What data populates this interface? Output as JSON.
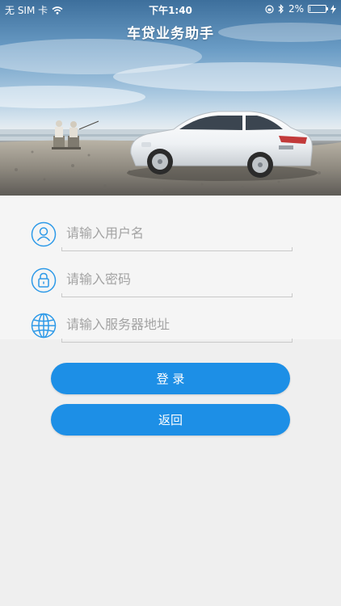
{
  "status_bar": {
    "carrier": "无 SIM 卡",
    "time": "下午1:40",
    "battery": "2%",
    "battery_level": 0.02
  },
  "header": {
    "title": "车贷业务助手"
  },
  "form": {
    "username_placeholder": "请输入用户名",
    "password_placeholder": "请输入密码",
    "server_placeholder": "请输入服务器地址"
  },
  "buttons": {
    "login": "登 录",
    "back": "返回"
  },
  "colors": {
    "accent": "#1d8fe6",
    "icon": "#2e9ae8"
  }
}
